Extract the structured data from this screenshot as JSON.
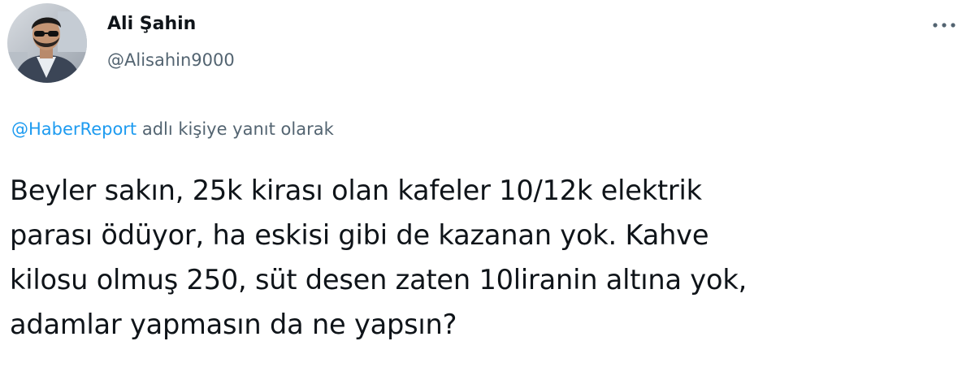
{
  "author": {
    "display_name": "Ali Şahin",
    "handle": "@Alisahin9000",
    "avatar_icon": "user-avatar-photo"
  },
  "more_icon": "more-horizontal-icon",
  "reply": {
    "mention": "@HaberReport",
    "suffix": " adlı kişiye yanıt olarak"
  },
  "tweet": {
    "lines": [
      "Beyler sakın, 25k kirası olan kafeler 10/12k elektrik",
      "parası ödüyor, ha eskisi gibi de kazanan yok. Kahve",
      "kilosu olmuş 250, süt desen zaten 10liranin altına yok,",
      "adamlar yapmasın da ne yapsın?"
    ]
  },
  "colors": {
    "text": "#0f1419",
    "secondary": "#536471",
    "link": "#1d9bf0"
  }
}
